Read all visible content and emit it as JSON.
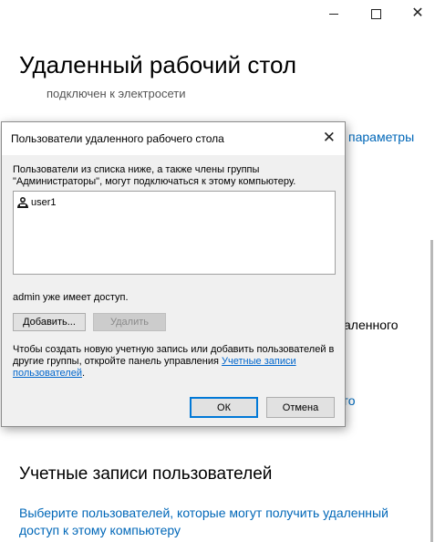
{
  "page": {
    "title": "Удаленный рабочий стол",
    "power_status": "подключен к электросети",
    "link_params_partial": "параметры",
    "text_partial": "аленного",
    "link_partial": "го",
    "section_title": "Учетные записи пользователей",
    "section_link": "Выберите пользователей, которые могут получить удаленный доступ к этому компьютеру"
  },
  "dialog": {
    "title": "Пользователи удаленного рабочего стола",
    "description": "Пользователи из списка ниже, а также члены группы \"Администраторы\", могут подключаться к этому компьютеру.",
    "users": [
      {
        "name": "user1"
      }
    ],
    "access_text": "admin уже имеет доступ.",
    "add_button": "Добавить...",
    "remove_button": "Удалить",
    "note_text": "Чтобы создать новую учетную запись или добавить пользователей в другие группы, откройте панель управления ",
    "note_link": "Учетные записи пользователей",
    "note_end": ".",
    "ok_button": "ОК",
    "cancel_button": "Отмена"
  },
  "colors": {
    "link": "#0067b8",
    "dialog_bg": "#f0f0f0",
    "ok_border": "#0078d7"
  },
  "icons": [
    "minimize-icon",
    "maximize-icon",
    "close-icon",
    "user-icon"
  ]
}
